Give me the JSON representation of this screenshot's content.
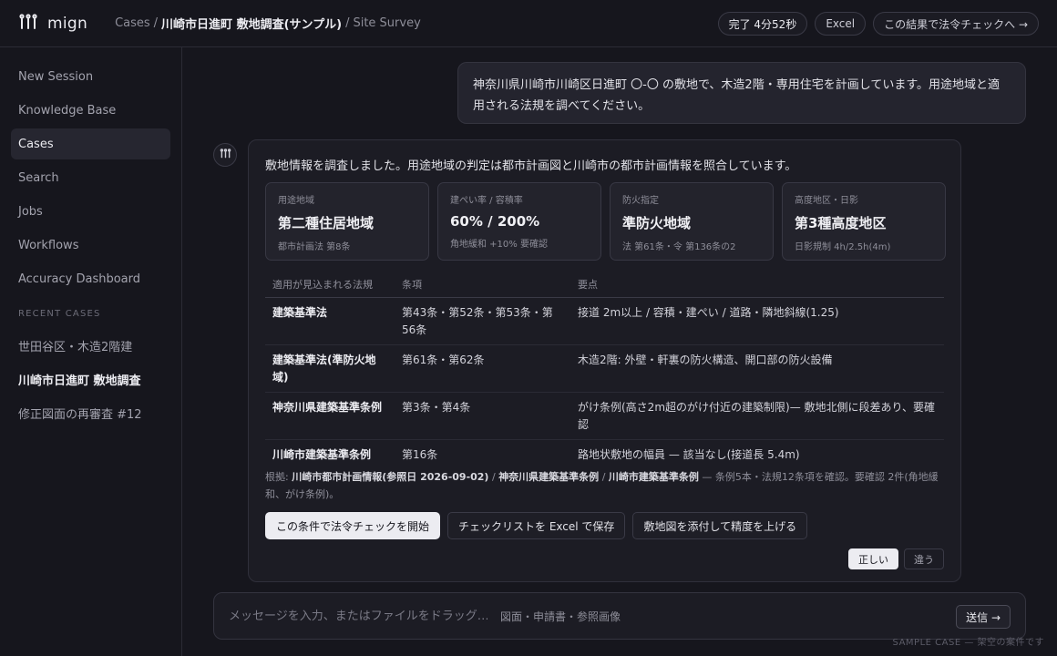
{
  "brand": {
    "name": "mign",
    "icon": "tripod-logo-icon"
  },
  "breadcrumb": {
    "root": "Cases",
    "separator": "/",
    "current": "川崎市日進町 敷地調査(サンプル)",
    "section": "Site Survey"
  },
  "header_actions": {
    "status": "完了 4分52秒",
    "excel": "Excel",
    "proceed": "この結果で法令チェックへ →"
  },
  "sidebar": {
    "items": [
      {
        "label": "New Session"
      },
      {
        "label": "Knowledge Base"
      },
      {
        "label": "Cases",
        "active": true
      },
      {
        "label": "Search"
      },
      {
        "label": "Jobs"
      },
      {
        "label": "Workflows"
      },
      {
        "label": "Accuracy Dashboard"
      }
    ],
    "recent_heading": "RECENT CASES",
    "recent": [
      {
        "label": "世田谷区・木造2階建"
      },
      {
        "label": "川崎市日進町 敷地調査",
        "current": true
      },
      {
        "label": "修正図面の再審査 #12"
      }
    ]
  },
  "user_message": "神奈川県川崎市川崎区日進町 〇-〇 の敷地で、木造2階・専用住宅を計画しています。用途地域と適用される法規を調べてください。",
  "assistant": {
    "avatar_icon": "tripod-logo-icon",
    "intro": "敷地情報を調査しました。用途地域の判定は都市計画図と川崎市の都市計画情報を照合しています。",
    "cards": [
      {
        "label": "用途地域",
        "value": "第二種住居地域",
        "note": "都市計画法 第8条"
      },
      {
        "label": "建ぺい率 / 容積率",
        "value": "60% / 200%",
        "note": "角地緩和 +10% 要確認"
      },
      {
        "label": "防火指定",
        "value": "準防火地域",
        "note": "法 第61条・令 第136条の2"
      },
      {
        "label": "高度地区・日影",
        "value": "第3種高度地区",
        "note": "日影規制 4h/2.5h(4m)"
      }
    ],
    "table": {
      "headers": [
        "適用が見込まれる法規",
        "条項",
        "要点"
      ],
      "rows": [
        {
          "law": "建築基準法",
          "articles": "第43条・第52条・第53条・第56条",
          "points": "接道 2m以上 / 容積・建ぺい / 道路・隣地斜線(1.25)"
        },
        {
          "law": "建築基準法(準防火地域)",
          "articles": "第61条・第62条",
          "points": "木造2階: 外壁・軒裏の防火構造、開口部の防火設備"
        },
        {
          "law": "神奈川県建築基準条例",
          "articles": "第3条・第4条",
          "points": "がけ条例(高さ2m超のがけ付近の建築制限)— 敷地北側に段差あり、要確認"
        },
        {
          "law": "川崎市建築基準条例",
          "articles": "第16条",
          "points": "路地状敷地の幅員 — 該当なし(接道長 5.4m)"
        }
      ]
    },
    "basis": {
      "prefix": "根拠:",
      "source1": "川崎市都市計画情報(参照日 2026-09-02)",
      "sep": "/",
      "source2": "神奈川県建築基準条例",
      "source3": "川崎市建築基準条例",
      "summary": "— 条例5本・法規12条項を確認。要確認 2件(角地緩和、がけ条例)。"
    },
    "actions": {
      "start": "この条件で法令チェックを開始",
      "save_excel": "チェックリストを Excel で保存",
      "attach": "敷地図を添付して精度を上げる"
    },
    "feedback": {
      "correct": "正しい",
      "wrong": "違う"
    }
  },
  "composer": {
    "placeholder": "メッセージを入力、またはファイルをドラッグ…",
    "hint": "図面・申請書・参照画像",
    "send": "送信 →"
  },
  "watermark": "SAMPLE CASE — 架空の案件です",
  "colors": {
    "background": "#16161d",
    "surface": "#1c1c24",
    "border": "#30303b",
    "text": "#ececf1",
    "muted": "#8e8e99",
    "primary_button": "#ececf1"
  }
}
